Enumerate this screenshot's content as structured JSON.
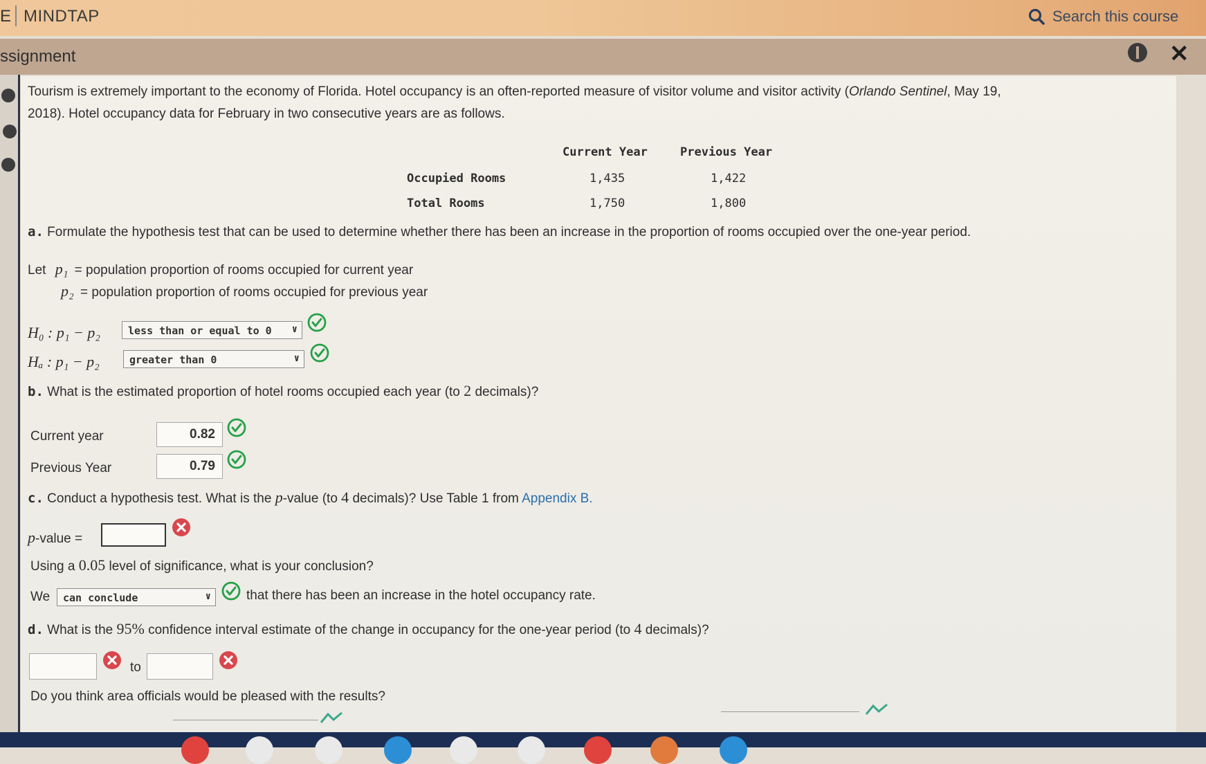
{
  "topbar": {
    "brand_fragment": "E",
    "brand": "MINDTAP",
    "search_label": "Search this course"
  },
  "titlebar": {
    "title": "ssignment"
  },
  "question": {
    "intro_line1_a": "Tourism is extremely important to the economy of Florida. Hotel occupancy is an often-reported measure of visitor volume and visitor activity (",
    "intro_source": "Orlando Sentinel",
    "intro_line1_b": ", May 19,",
    "intro_line2": "2018). Hotel occupancy data for February in two consecutive years are as follows.",
    "table": {
      "headers": [
        "Current Year",
        "Previous Year"
      ],
      "rows": [
        {
          "label": "Occupied Rooms",
          "current": "1,435",
          "previous": "1,422"
        },
        {
          "label": "Total Rooms",
          "current": "1,750",
          "previous": "1,800"
        }
      ]
    },
    "part_a": {
      "prefix": "a.",
      "text": "Formulate the hypothesis test that can be used to determine whether there has been an increase in the proportion of rooms occupied over the one-year period.",
      "let": "Let",
      "p1": "p₁",
      "p2": "p₂",
      "equals": "=",
      "p1_def": "population proportion of rooms occupied for current year",
      "p2_def": "population proportion of rooms occupied for previous year",
      "h0_label": "H₀ : p₁ − p₂",
      "ha_label": "Hₐ : p₁ − p₂",
      "h0_value": "less than or equal to 0",
      "ha_value": "greater than 0"
    },
    "part_b": {
      "prefix": "b.",
      "text_a": "What is the estimated proportion of hotel rooms occupied each year (to",
      "decimals": "2",
      "text_b": "decimals)?",
      "current_label": "Current year",
      "current_value": "0.82",
      "previous_label": "Previous Year",
      "previous_value": "0.79"
    },
    "part_c": {
      "prefix": "c.",
      "text_a": "Conduct a hypothesis test. What is the",
      "p": "p",
      "text_b": "-value (to",
      "decimals": "4",
      "text_c": "decimals)? Use Table 1 from",
      "link": "Appendix B.",
      "pvalue_label": "p",
      "pvalue_suffix": "-value =",
      "pvalue_value": "",
      "sig_a": "Using a",
      "sig_value": "0.05",
      "sig_b": "level of significance, what is your conclusion?",
      "we": "We",
      "conclusion_value": "can conclude",
      "conclusion_text": "that there has been an increase in the hotel occupancy rate."
    },
    "part_d": {
      "prefix": "d.",
      "text_a": "What is the",
      "confidence": "95%",
      "text_b": "confidence interval estimate of the change in occupancy for the one-year period (to",
      "decimals": "4",
      "text_c": "decimals)?",
      "lower": "",
      "to": "to",
      "upper": ""
    },
    "part_e": {
      "text": "Do you think area officials would be pleased with the results?"
    }
  },
  "colors": {
    "ok_green": "#25a14a",
    "error_red": "#d8474d",
    "link_blue": "#2a6fad"
  }
}
